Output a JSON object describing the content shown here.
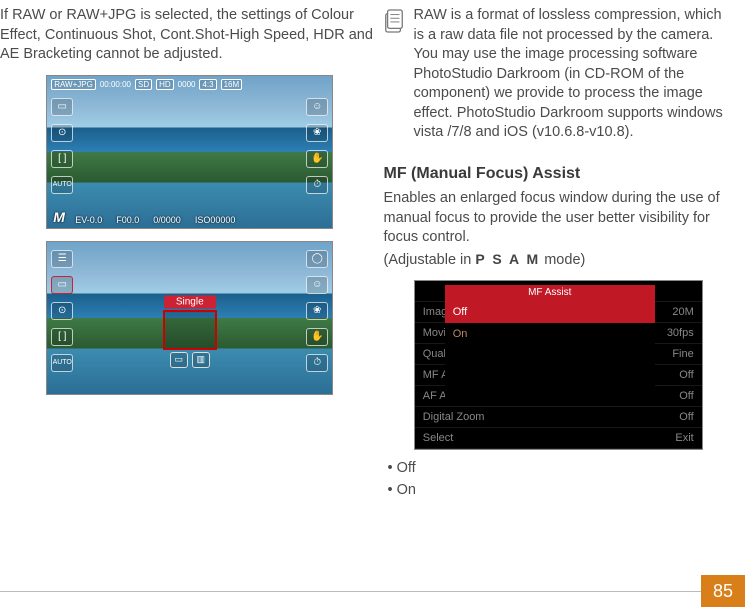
{
  "left": {
    "intro": "If RAW or RAW+JPG is selected, the settings of Colour Effect, Continuous Shot, Cont.Shot-High Speed, HDR and AE Bracketing cannot be adjusted."
  },
  "shot1": {
    "top_badge": "RAW+JPG",
    "time": "00:00:00",
    "sd": "SD",
    "hd": "HD",
    "count": "0000",
    "ratio": "4:3",
    "mp": "16M",
    "mode_letter": "M",
    "ev": "EV-0.0",
    "f": "F00.0",
    "frac": "0/0000",
    "iso": "ISO00000"
  },
  "shot2": {
    "single_label": "Single"
  },
  "right": {
    "note": "RAW is a format of lossless compression, which is a raw data file not processed by the camera. You may use the image processing software PhotoStudio Darkroom (in CD-ROM of the component) we provide to process the image effect. PhotoStudio Darkroom supports windows vista /7/8 and iOS (v10.6.8-v10.8).",
    "mf_heading": "MF (Manual Focus) Assist",
    "mf_body": "Enables an enlarged focus window during the use of manual focus to provide the user better visibility for focus control.",
    "mf_adjustable_prefix": "(Adjustable in ",
    "mf_adjustable_modes": "P S A M",
    "mf_adjustable_suffix": " mode)"
  },
  "menu": {
    "bg_rows": [
      {
        "l": "",
        "r": ""
      },
      {
        "l": "Image Size",
        "r": "20M"
      },
      {
        "l": "Movie Size",
        "r": "30fps"
      },
      {
        "l": "Quality",
        "r": "Fine"
      },
      {
        "l": "MF Assist",
        "r": "Off"
      },
      {
        "l": "AF Assist Beam",
        "r": "Off"
      },
      {
        "l": "Digital Zoom",
        "r": "Off"
      },
      {
        "l": "Select",
        "r": "Exit"
      }
    ],
    "overlay_title": "MF Assist",
    "overlay_off": "Off",
    "overlay_on": "On"
  },
  "bullets": {
    "off": "• Off",
    "on": "• On"
  },
  "page_number": "85"
}
